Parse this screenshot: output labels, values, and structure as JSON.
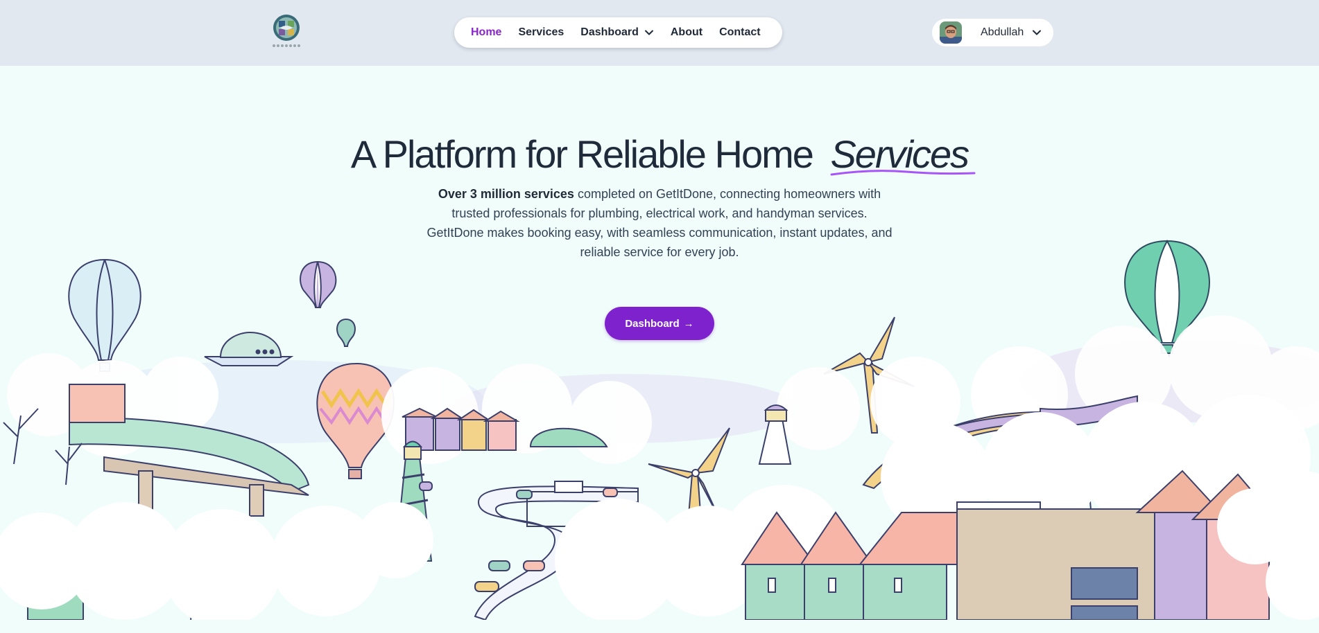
{
  "header": {
    "logo_alt": "GetItDone logo",
    "nav": [
      {
        "label": "Home",
        "active": true
      },
      {
        "label": "Services"
      },
      {
        "label": "Dashboard",
        "has_dropdown": true
      },
      {
        "label": "About"
      },
      {
        "label": "Contact"
      }
    ],
    "user": {
      "name": "Abdullah",
      "icon": "chevron-down-icon"
    }
  },
  "hero": {
    "title_main": "A Platform for Reliable Home",
    "title_emphasis": "Services",
    "subtitle_bold": "Over 3 million services",
    "subtitle_rest": " completed on GetItDone, connecting homeowners with trusted professionals for plumbing, electrical work, and handyman services. GetItDone makes booking easy, with seamless communication, instant updates, and reliable service for every job.",
    "cta_label": "Dashboard",
    "cta_icon": "→"
  },
  "colors": {
    "accent": "#7e22ce",
    "active_nav": "#8b24c9",
    "header_bg": "#e2e8f0",
    "page_bg": "#f0fdfa"
  }
}
